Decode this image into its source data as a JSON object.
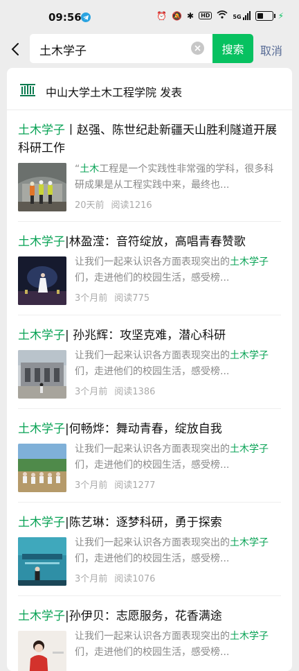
{
  "status": {
    "time": "09:56",
    "hd": "HD",
    "signal": "5G"
  },
  "search": {
    "query": "土木学子",
    "button": "搜索",
    "cancel": "取消"
  },
  "publisher": {
    "name": "中山大学土木工程学院 发表"
  },
  "articles": [
    {
      "t_hl": "土木学子",
      "t_rest": "丨赵强、陈世纪赴新疆天山胜利隧道开展科研工作",
      "d_pre": "“",
      "d_hl": "土木",
      "d_rest": "工程是一个实践性非常强的学科，很多科研成果是从工程实践中来，最终也...",
      "time": "20天前",
      "reads": "阅读1216"
    },
    {
      "t_hl": "土木学子",
      "t_rest": "|林盈滢：音符绽放，高唱青春赞歌",
      "d_pre": "让我们一起来认识各方面表现突出的",
      "d_hl": "土木学子",
      "d_rest": "们，走进他们的校园生活，感受榜...",
      "time": "3个月前",
      "reads": "阅读775"
    },
    {
      "t_hl": "土木学子",
      "t_rest": "| 孙兆辉：攻坚克难，潜心科研",
      "d_pre": "让我们一起来认识各方面表现突出的",
      "d_hl": "土木学子",
      "d_rest": "们，走进他们的校园生活，感受榜...",
      "time": "3个月前",
      "reads": "阅读1386"
    },
    {
      "t_hl": "土木学子",
      "t_rest": "|何畅烨：舞动青春，绽放自我",
      "d_pre": "让我们一起来认识各方面表现突出的",
      "d_hl": "土木学子",
      "d_rest": "们，走进他们的校园生活，感受榜...",
      "time": "3个月前",
      "reads": "阅读1277"
    },
    {
      "t_hl": "土木学子",
      "t_rest": "|陈艺琳：逐梦科研，勇于探索",
      "d_pre": "让我们一起来认识各方面表现突出的",
      "d_hl": "土木学子",
      "d_rest": "们，走进他们的校园生活，感受榜...",
      "time": "3个月前",
      "reads": "阅读1076"
    },
    {
      "t_hl": "土木学子",
      "t_rest": "|孙伊贝：志愿服务，花香满途",
      "d_pre": "让我们一起来认识各方面表现突出的",
      "d_hl": "土木学子",
      "d_rest": "们，走进他们的校园生活，感受榜...",
      "time": "",
      "reads": ""
    }
  ],
  "colors": {
    "accent": "#07c160",
    "highlight": "#07a254",
    "link": "#576b95",
    "background": "#ededed"
  }
}
